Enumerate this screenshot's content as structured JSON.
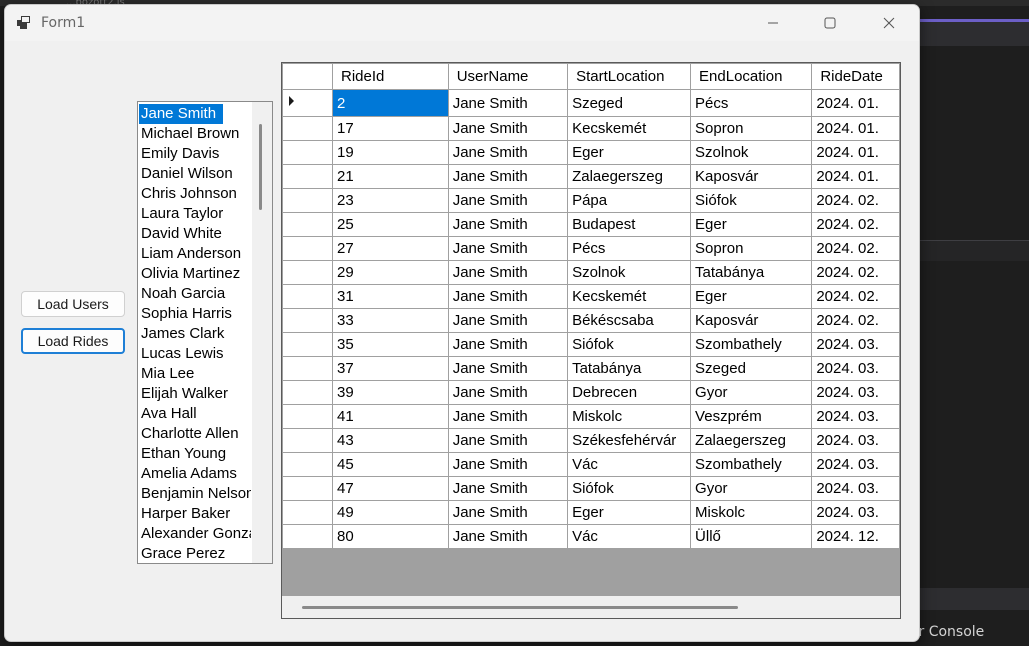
{
  "window": {
    "title": "Form1"
  },
  "background": {
    "console_label": "ger Console",
    "faded_tab": "...bozott2.js"
  },
  "buttons": {
    "load_users": "Load Users",
    "load_rides": "Load Rides"
  },
  "users": {
    "selected": "Jane Smith",
    "items": [
      "Jane Smith",
      "Michael Brown",
      "Emily Davis",
      "Daniel Wilson",
      "Chris Johnson",
      "Laura Taylor",
      "David White",
      "Liam Anderson",
      "Olivia Martinez",
      "Noah Garcia",
      "Sophia Harris",
      "James Clark",
      "Lucas Lewis",
      "Mia Lee",
      "Elijah Walker",
      "Ava Hall",
      "Charlotte Allen",
      "Ethan Young",
      "Amelia Adams",
      "Benjamin Nelson",
      "Harper Baker",
      "Alexander Gonzalez",
      "Grace Perez"
    ]
  },
  "rides": {
    "columns": [
      "RideId",
      "UserName",
      "StartLocation",
      "EndLocation",
      "RideDate"
    ],
    "rows": [
      [
        "2",
        "Jane Smith",
        "Szeged",
        "Pécs",
        "2024. 01."
      ],
      [
        "17",
        "Jane Smith",
        "Kecskemét",
        "Sopron",
        "2024. 01."
      ],
      [
        "19",
        "Jane Smith",
        "Eger",
        "Szolnok",
        "2024. 01."
      ],
      [
        "21",
        "Jane Smith",
        "Zalaegerszeg",
        "Kaposvár",
        "2024. 01."
      ],
      [
        "23",
        "Jane Smith",
        "Pápa",
        "Siófok",
        "2024. 02."
      ],
      [
        "25",
        "Jane Smith",
        "Budapest",
        "Eger",
        "2024. 02."
      ],
      [
        "27",
        "Jane Smith",
        "Pécs",
        "Sopron",
        "2024. 02."
      ],
      [
        "29",
        "Jane Smith",
        "Szolnok",
        "Tatabánya",
        "2024. 02."
      ],
      [
        "31",
        "Jane Smith",
        "Kecskemét",
        "Eger",
        "2024. 02."
      ],
      [
        "33",
        "Jane Smith",
        "Békéscsaba",
        "Kaposvár",
        "2024. 02."
      ],
      [
        "35",
        "Jane Smith",
        "Siófok",
        "Szombathely",
        "2024. 03."
      ],
      [
        "37",
        "Jane Smith",
        "Tatabánya",
        "Szeged",
        "2024. 03."
      ],
      [
        "39",
        "Jane Smith",
        "Debrecen",
        "Gyor",
        "2024. 03."
      ],
      [
        "41",
        "Jane Smith",
        "Miskolc",
        "Veszprém",
        "2024. 03."
      ],
      [
        "43",
        "Jane Smith",
        "Székesfehérvár",
        "Zalaegerszeg",
        "2024. 03."
      ],
      [
        "45",
        "Jane Smith",
        "Vác",
        "Szombathely",
        "2024. 03."
      ],
      [
        "47",
        "Jane Smith",
        "Siófok",
        "Gyor",
        "2024. 03."
      ],
      [
        "49",
        "Jane Smith",
        "Eger",
        "Miskolc",
        "2024. 03."
      ],
      [
        "80",
        "Jane Smith",
        "Vác",
        "Üllő",
        "2024. 12."
      ]
    ]
  },
  "colors": {
    "accent": "#0078d7",
    "focus_border": "#1e7fd6",
    "grid_empty": "#a0a0a0"
  }
}
